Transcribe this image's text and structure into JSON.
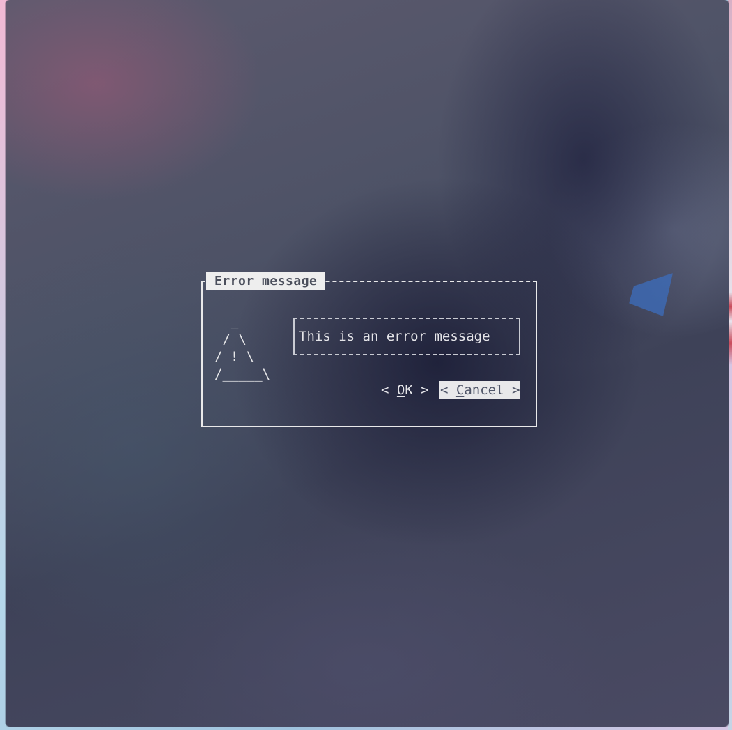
{
  "dialog": {
    "title": "Error message",
    "warning_art": "  _\n / \\\n/ ! \\\n/_____\\",
    "message": "This is an error message",
    "buttons": {
      "ok": {
        "prefix": "< ",
        "hotkey": "O",
        "rest": "K",
        "suffix": " >"
      },
      "cancel": {
        "prefix": "< ",
        "hotkey": "C",
        "rest": "ancel",
        "suffix": " >",
        "selected": true
      }
    }
  },
  "colors": {
    "dialog_border": "#e9e9ea",
    "title_bg": "#eeeeee",
    "title_text": "#4b4f5c",
    "selected_button_bg": "#e8e8ea",
    "selected_button_text": "#4f5568",
    "text": "#e6e6e8"
  },
  "icons": {
    "warning": "warning-triangle-icon"
  }
}
